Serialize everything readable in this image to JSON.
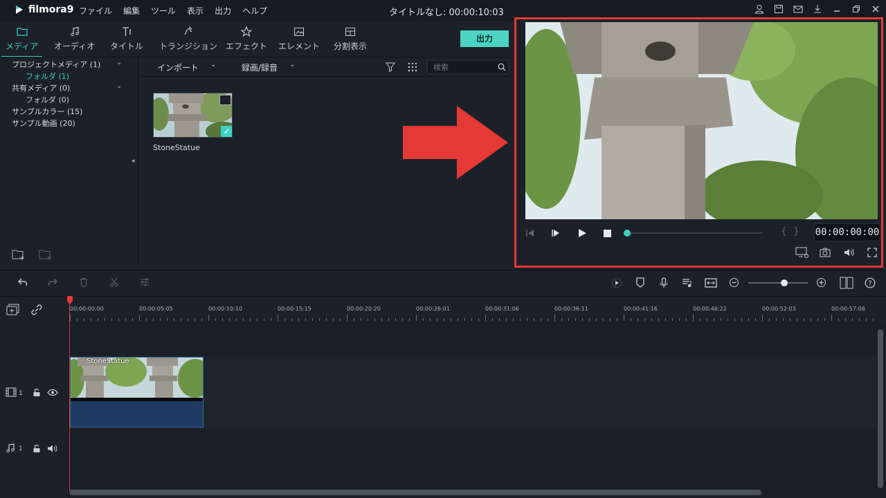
{
  "app": {
    "name": "filmora9",
    "title": "タイトルなし: 00:00:10:03"
  },
  "menu": [
    "ファイル",
    "編集",
    "ツール",
    "表示",
    "出力",
    "ヘルプ"
  ],
  "window_icons": [
    "user-icon",
    "save-icon",
    "mail-icon",
    "download-icon",
    "minimize-icon",
    "restore-icon",
    "close-icon"
  ],
  "tabs": [
    {
      "label": "メディア",
      "icon": "folder-icon"
    },
    {
      "label": "オーディオ",
      "icon": "music-note-icon"
    },
    {
      "label": "タイトル",
      "icon": "text-icon"
    },
    {
      "label": "トランジション",
      "icon": "transition-icon"
    },
    {
      "label": "エフェクト",
      "icon": "effect-icon"
    },
    {
      "label": "エレメント",
      "icon": "image-icon"
    },
    {
      "label": "分割表示",
      "icon": "splitscreen-icon"
    }
  ],
  "export_label": "出力",
  "library": {
    "project_media": "プロジェクトメディア (1)",
    "project_folder": "フォルダ (1)",
    "shared_media": "共有メディア (0)",
    "shared_folder": "フォルダ (0)",
    "sample_colors": "サンプルカラー (15)",
    "sample_videos": "サンプル動画 (20)"
  },
  "media_toolbar": {
    "import": "インポート",
    "record": "録画/録音",
    "search_placeholder": "検索"
  },
  "media_items": [
    {
      "name": "StoneStatue"
    }
  ],
  "preview": {
    "timecode": "00:00:00:00",
    "progress": 0
  },
  "ruler_ticks": [
    "00:00:00:00",
    "00:00:05:05",
    "00:00:10:10",
    "00:00:15:15",
    "00:00:20:20",
    "00:00:26:01",
    "00:00:31:06",
    "00:00:36:11",
    "00:00:41:16",
    "00:00:46:22",
    "00:00:52:03",
    "00:00:57:08"
  ],
  "tracks": {
    "video_label": "1",
    "audio_label": "1",
    "clip_name": "StoneStatue"
  },
  "zoom_level": 0.6,
  "colors": {
    "accent": "#3cd2c3",
    "highlight": "#e53935",
    "clip": "#1e3a60"
  }
}
